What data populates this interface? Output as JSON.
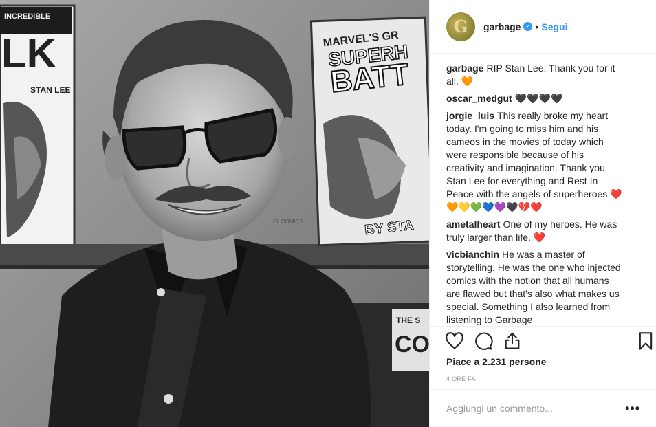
{
  "post": {
    "username": "garbage",
    "avatar_letter": "G",
    "follow_label": "Segui",
    "separator": "•"
  },
  "photo": {
    "left_cover_title": "INCREDIBLE",
    "left_cover_big": "LK",
    "left_cover_credit": "STAN LEE",
    "right_cover_top": "MARVEL'S GR",
    "right_cover_mid": "SUPERH",
    "right_cover_big": "BATT",
    "right_cover_credit": "BY STA",
    "shelf_small_label": "THE S",
    "shelf_small_big": "CO",
    "lower_note": "EL COMICS"
  },
  "comments": [
    {
      "author": "garbage",
      "text": "RIP Stan Lee. Thank you for it all. 🧡",
      "liked_icon": false
    },
    {
      "author": "oscar_medgut",
      "text": "🖤🖤🖤🖤",
      "liked_icon": true
    },
    {
      "author": "jorgie_luis",
      "text": "This really broke my heart today. I'm going to miss him and his cameos in the movies of today which were responsible because of his creativity and imagination. Thank you Stan Lee for everything and Rest In Peace with the angels of superheroes ❤️🧡💛💚💙💜🖤💔❤️",
      "liked_icon": true
    },
    {
      "author": "ametalheart",
      "text": "One of my heroes. He was truly larger than life. ❤️",
      "liked_icon": true
    },
    {
      "author": "vicbianchin",
      "text": "He was a master of storytelling. He was the one who injected comics with the notion that all humans are flawed but that's also what makes us special. Something I also learned from listening to Garbage",
      "liked_icon": true
    }
  ],
  "actions": {
    "like_icon": "heart-icon",
    "comment_icon": "comment-bubble-icon",
    "share_icon": "share-icon",
    "save_icon": "bookmark-icon"
  },
  "likes_text": "Piace a 2.231 persone",
  "timestamp": "4 ORE FA",
  "comment_box": {
    "placeholder": "Aggiungi un commento...",
    "more_label": "•••"
  },
  "colors": {
    "accent": "#3897f0",
    "text": "#262626",
    "muted": "#999999",
    "divider": "#efefef"
  }
}
